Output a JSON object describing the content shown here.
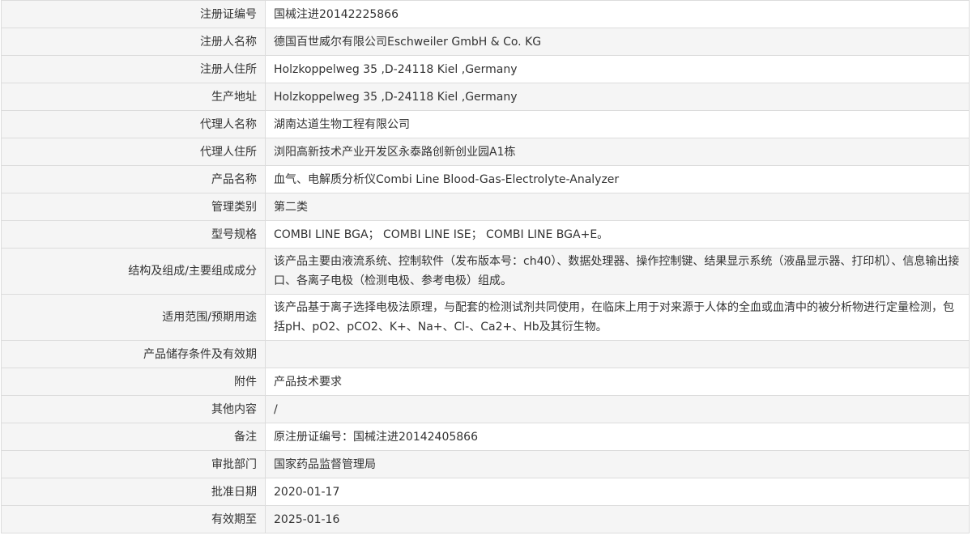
{
  "records": [
    {
      "label": "注册证编号",
      "value": "国械注进20142225866"
    },
    {
      "label": "注册人名称",
      "value": "德国百世威尔有限公司Eschweiler GmbH & Co. KG"
    },
    {
      "label": "注册人住所",
      "value": "Holzkoppelweg 35 ,D-24118 Kiel ,Germany"
    },
    {
      "label": "生产地址",
      "value": "Holzkoppelweg 35 ,D-24118 Kiel ,Germany"
    },
    {
      "label": "代理人名称",
      "value": "湖南达道生物工程有限公司"
    },
    {
      "label": "代理人住所",
      "value": "浏阳高新技术产业开发区永泰路创新创业园A1栋"
    },
    {
      "label": "产品名称",
      "value": "血气、电解质分析仪Combi Line Blood-Gas-Electrolyte-Analyzer"
    },
    {
      "label": "管理类别",
      "value": "第二类"
    },
    {
      "label": "型号规格",
      "value": "COMBI LINE BGA； COMBI LINE ISE； COMBI LINE BGA+E。"
    },
    {
      "label": "结构及组成/主要组成成分",
      "value": "该产品主要由液流系统、控制软件（发布版本号：ch40）、数据处理器、操作控制键、结果显示系统（液晶显示器、打印机）、信息输出接口、各离子电极（检测电极、参考电极）组成。"
    },
    {
      "label": "适用范围/预期用途",
      "value": "该产品基于离子选择电极法原理，与配套的检测试剂共同使用，在临床上用于对来源于人体的全血或血清中的被分析物进行定量检测，包括pH、pO2、pCO2、K+、Na+、Cl-、Ca2+、Hb及其衍生物。"
    },
    {
      "label": "产品储存条件及有效期",
      "value": ""
    },
    {
      "label": "附件",
      "value": "产品技术要求"
    },
    {
      "label": "其他内容",
      "value": "/"
    },
    {
      "label": "备注",
      "value": "原注册证编号：国械注进20142405866"
    },
    {
      "label": "审批部门",
      "value": "国家药品监督管理局"
    },
    {
      "label": "批准日期",
      "value": "2020-01-17"
    },
    {
      "label": "有效期至",
      "value": "2025-01-16"
    }
  ]
}
